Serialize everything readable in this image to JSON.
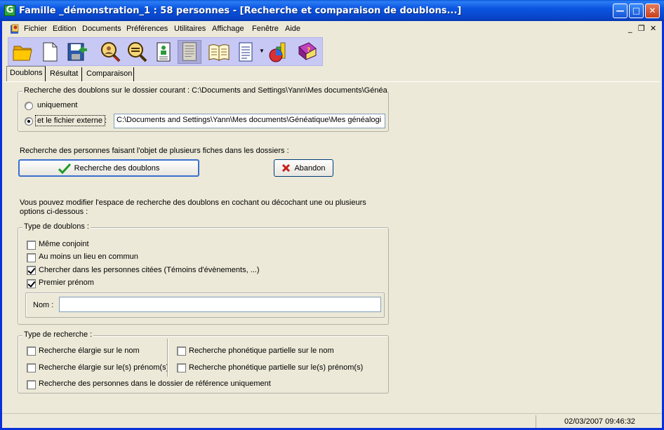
{
  "window": {
    "title": "Famille _démonstration_1 : 58 personnes - [Recherche et comparaison de doublons...]",
    "app_icon_letter": "G"
  },
  "menubar": {
    "items": [
      "Fichier",
      "Edition",
      "Documents",
      "Préférences",
      "Utilitaires",
      "Affichage",
      "Fenêtre",
      "Aide"
    ]
  },
  "toolbar": {
    "icons": [
      "open-folder-icon",
      "new-document-icon",
      "save-exit-icon",
      "search-person-icon",
      "compare-icon",
      "person-card-icon",
      "book-page-icon",
      "open-book-icon",
      "list-report-icon",
      "statistics-chart-icon",
      "help-book-icon"
    ]
  },
  "tabs": [
    "Doublons",
    "Résultat",
    "Comparaison"
  ],
  "search_scope": {
    "legend": "Recherche des doublons sur le dossier courant : C:\\Documents and Settings\\Yann\\Mes documents\\Généatiq",
    "option_only": "uniquement",
    "option_external": "et le fichier externe :",
    "external_path": "C:\\Documents and Settings\\Yann\\Mes documents\\Généatique\\Mes généalogi"
  },
  "search_action": {
    "intro": "Recherche des personnes faisant l'objet de plusieurs fiches dans les dossiers :",
    "search_label": "Recherche des doublons",
    "cancel_label": "Abandon"
  },
  "info_text": {
    "line1": "Vous pouvez modifier l'espace de recherche des doublons en cochant ou décochant une ou plusieurs",
    "line2": "options ci-dessous :"
  },
  "duplicate_type": {
    "legend": "Type de doublons :",
    "options": [
      {
        "label": "Même conjoint",
        "checked": false
      },
      {
        "label": "Au moins un lieu en commun",
        "checked": false
      },
      {
        "label": "Chercher dans les personnes citées (Témoins d'évènements, ...)",
        "checked": true
      },
      {
        "label": "Premier prénom",
        "checked": true
      }
    ],
    "name_label": "Nom :",
    "name_value": ""
  },
  "search_type": {
    "legend": "Type de recherche :",
    "left": [
      {
        "label": "Recherche élargie sur le nom",
        "checked": false
      },
      {
        "label": "Recherche élargie sur le(s) prénom(s)",
        "checked": false
      }
    ],
    "right": [
      {
        "label": "Recherche phonétique partielle sur le nom",
        "checked": false
      },
      {
        "label": "Recherche phonétique partielle sur le(s) prénom(s)",
        "checked": false
      }
    ],
    "bottom": {
      "label": "Recherche des personnes dans le dossier de référence uniquement",
      "checked": false
    }
  },
  "statusbar": {
    "datetime": "02/03/2007 09:46:32"
  }
}
